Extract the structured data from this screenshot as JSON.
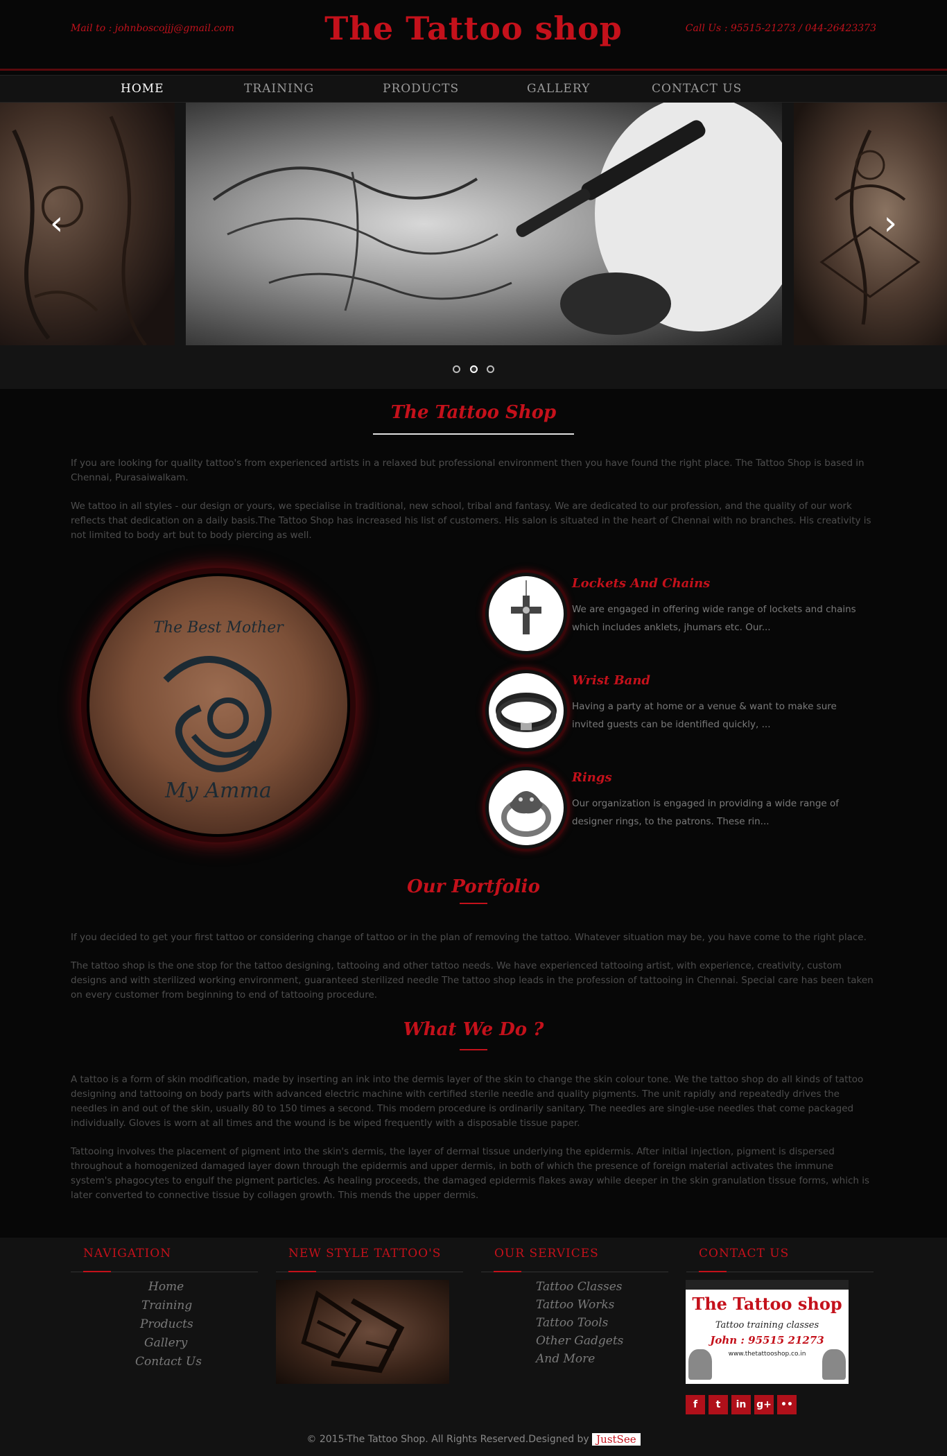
{
  "header": {
    "mail": "Mail to : johnboscojjj@gmail.com",
    "logo": "The Tattoo shop",
    "call": "Call Us : 95515-21273 / 044-26423373"
  },
  "nav": {
    "items": [
      "HOME",
      "TRAINING",
      "PRODUCTS",
      "GALLERY",
      "CONTACT US"
    ],
    "active": "HOME"
  },
  "slider": {
    "prev_icon": "chevron-left-icon",
    "next_icon": "chevron-right-icon",
    "slides_count": 3,
    "active_dot": 2
  },
  "intro": {
    "title": "The Tattoo Shop",
    "para1": "If you are looking for quality tattoo's from experienced artists in a relaxed but professional environment then you have found the right place. The Tattoo Shop is based in Chennai, Purasaiwalkam.",
    "para2": "We tattoo in all styles - our design or yours, we specialise in traditional, new school, tribal and fantasy. We are dedicated to our profession, and the quality of our work reflects that dedication on a daily basis.The Tattoo Shop has increased his list of customers. His salon is situated in the heart of Chennai with no branches. His creativity is not limited to body art but to body piercing as well."
  },
  "tattoo_image": {
    "text_top": "The Best Mother",
    "text_bottom": "My Amma"
  },
  "features": [
    {
      "title": "Lockets And Chains",
      "desc": "We are engaged in offering wide range of lockets and chains which includes anklets, jhumars etc. Our...",
      "icon": "cross-locket-icon"
    },
    {
      "title": "Wrist Band",
      "desc": "Having a party at home or a venue & want to make sure invited guests can be identified quickly, ...",
      "icon": "wrist-band-icon"
    },
    {
      "title": "Rings",
      "desc": "Our organization is engaged in providing a wide range of designer rings, to the patrons. These rin...",
      "icon": "ring-icon"
    }
  ],
  "portfolio": {
    "title": "Our Portfolio",
    "para1": "If you decided to get your first tattoo or considering change of tattoo or in the plan of removing the tattoo. Whatever situation may be, you have come to the right place.",
    "para2": "The tattoo shop is the one stop for the tattoo designing, tattooing and other tattoo needs. We have experienced tattooing artist, with experience, creativity, custom designs and with sterilized working environment, guaranteed sterilized needle The tattoo shop leads in the profession of tattooing in Chennai. Special care has been taken on every customer from beginning to end of tattooing procedure."
  },
  "whatwedo": {
    "title": "What We Do ?",
    "para1": "A tattoo is a form of skin modification, made by inserting an ink into the dermis layer of the skin to change the skin colour tone. We the tattoo shop do all kinds of tattoo designing and tattooing on body parts with advanced electric machine with certified sterile needle and quality pigments. The unit rapidly and repeatedly drives the needles in and out of the skin, usually 80 to 150 times a second. This modern procedure is ordinarily sanitary. The needles are single-use needles that come packaged individually. Gloves is worn at all times and the wound is be wiped frequently with a disposable tissue paper.",
    "para2": "Tattooing involves the placement of pigment into the skin's dermis, the layer of dermal tissue underlying the epidermis. After initial injection, pigment is dispersed throughout a homogenized damaged layer down through the epidermis and upper dermis, in both of which the presence of foreign material activates the immune system's phagocytes to engulf the pigment particles. As healing proceeds, the damaged epidermis flakes away while deeper in the skin granulation tissue forms, which is later converted to connective tissue by collagen growth. This mends the upper dermis."
  },
  "footer": {
    "navigation": {
      "title": "NAVIGATION",
      "links": [
        "Home",
        "Training",
        "Products",
        "Gallery",
        "Contact Us"
      ]
    },
    "new_style": {
      "title": "NEW STYLE TATTOO'S"
    },
    "services": {
      "title": "OUR SERVICES",
      "links": [
        "Tattoo Classes",
        "Tattoo Works",
        "Tattoo Tools",
        "Other Gadgets",
        "And More"
      ]
    },
    "contact": {
      "title": "CONTACT US",
      "card_logo": "The Tattoo shop",
      "card_sub": "Tattoo training classes",
      "card_phone": "John : 95515 21273",
      "card_web": "www.thetattooshop.co.in"
    },
    "social": [
      {
        "icon": "facebook-icon",
        "glyph": "f"
      },
      {
        "icon": "twitter-icon",
        "glyph": "t"
      },
      {
        "icon": "linkedin-icon",
        "glyph": "in"
      },
      {
        "icon": "google-plus-icon",
        "glyph": "g+"
      },
      {
        "icon": "flickr-icon",
        "glyph": "••"
      }
    ],
    "copyright": "© 2015-The Tattoo Shop. All Rights Reserved.Designed by",
    "designer": "JustSee"
  },
  "colors": {
    "accent": "#c4111b",
    "background": "#070707",
    "footer_bg": "#121212"
  }
}
